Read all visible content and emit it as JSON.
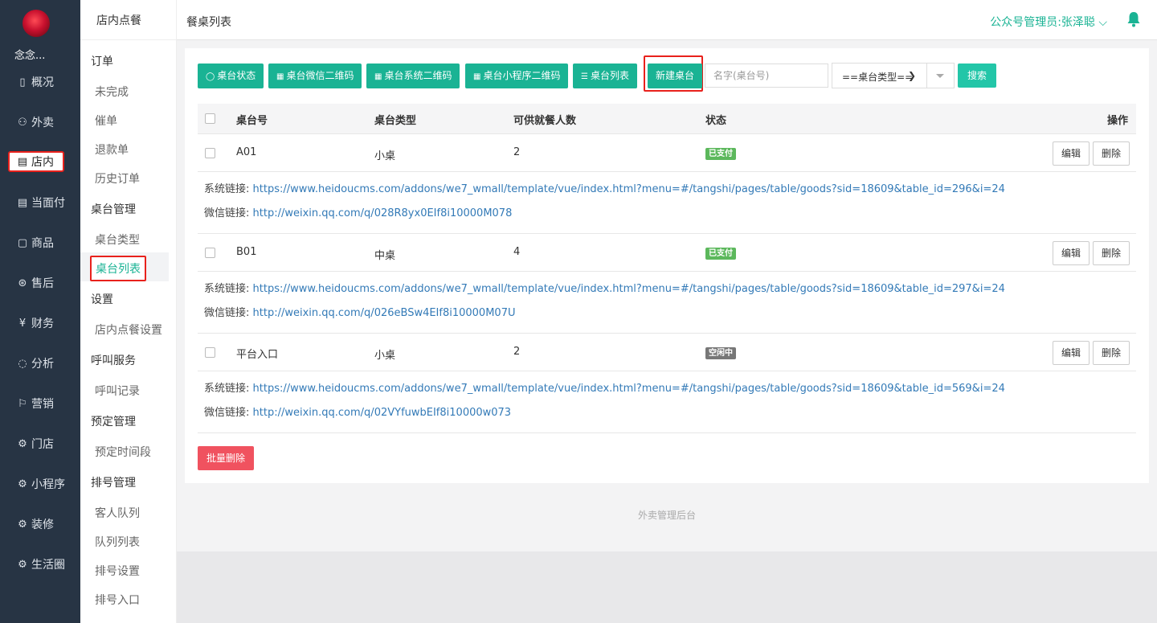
{
  "nav": {
    "shop_name": "念念...",
    "items": [
      {
        "label": "概况",
        "icon": "dashboard-icon",
        "glyph": "▯"
      },
      {
        "label": "外卖",
        "icon": "delivery-icon",
        "glyph": "⚇"
      },
      {
        "label": "店内",
        "icon": "store-icon",
        "glyph": "▤"
      },
      {
        "label": "当面付",
        "icon": "receipt-icon",
        "glyph": "▤"
      },
      {
        "label": "商品",
        "icon": "bag-icon",
        "glyph": "▢"
      },
      {
        "label": "售后",
        "icon": "service-icon",
        "glyph": "⊛"
      },
      {
        "label": "财务",
        "icon": "yuan-icon",
        "glyph": "¥"
      },
      {
        "label": "分析",
        "icon": "chart-icon",
        "glyph": "◌"
      },
      {
        "label": "营销",
        "icon": "flag-icon",
        "glyph": "⚐"
      },
      {
        "label": "门店",
        "icon": "gear-icon",
        "glyph": "⚙"
      },
      {
        "label": "小程序",
        "icon": "gear-icon",
        "glyph": "⚙"
      },
      {
        "label": "装修",
        "icon": "gear-icon",
        "glyph": "⚙"
      },
      {
        "label": "生活圈",
        "icon": "gear-icon",
        "glyph": "⚙"
      }
    ]
  },
  "subnav": {
    "header": "店内点餐",
    "groups": [
      "订单",
      "桌台管理",
      "设置",
      "呼叫服务",
      "预定管理",
      "排号管理"
    ],
    "items": [
      "未完成",
      "催单",
      "退款单",
      "历史订单",
      "桌台类型",
      "桌台列表",
      "店内点餐设置",
      "呼叫记录",
      "预定时间段",
      "客人队列",
      "队列列表",
      "排号设置",
      "排号入口"
    ]
  },
  "topbar": {
    "breadcrumb": "餐桌列表",
    "user": "公众号管理员:张泽聪 ⌵"
  },
  "toolbar": {
    "table_status": "桌台状态",
    "wechat_qr": "桌台微信二维码",
    "system_qr": "桌台系统二维码",
    "miniprogram_qr": "桌台小程序二维码",
    "table_list": "桌台列表",
    "new_table": "新建桌台",
    "search_placeholder": "名字(桌台号)",
    "type_select": "==桌台类型==",
    "search": "搜索"
  },
  "table": {
    "headers": {
      "number": "桌台号",
      "type": "桌台类型",
      "seats": "可供就餐人数",
      "status": "状态",
      "actions": "操作"
    },
    "link_labels": {
      "system": "系统链接:",
      "wechat": "微信链接:"
    },
    "edit": "编辑",
    "delete": "删除",
    "rows": [
      {
        "number": "A01",
        "type": "小桌",
        "seats": "2",
        "status": "已支付",
        "status_color": "#5cb85c",
        "system_link": "https://www.heidoucms.com/addons/we7_wmall/template/vue/index.html?menu=#/tangshi/pages/table/goods?sid=18609&table_id=296&i=24",
        "wechat_link": "http://weixin.qq.com/q/028R8yx0EIf8i10000M078"
      },
      {
        "number": "B01",
        "type": "中桌",
        "seats": "4",
        "status": "已支付",
        "status_color": "#5cb85c",
        "system_link": "https://www.heidoucms.com/addons/we7_wmall/template/vue/index.html?menu=#/tangshi/pages/table/goods?sid=18609&table_id=297&i=24",
        "wechat_link": "http://weixin.qq.com/q/026eBSw4EIf8i10000M07U"
      },
      {
        "number": "平台入口",
        "type": "小桌",
        "seats": "2",
        "status": "空闲中",
        "status_color": "#777777",
        "system_link": "https://www.heidoucms.com/addons/we7_wmall/template/vue/index.html?menu=#/tangshi/pages/table/goods?sid=18609&table_id=569&i=24",
        "wechat_link": "http://weixin.qq.com/q/02VYfuwbEIf8i10000w073"
      }
    ],
    "batch_delete": "批量删除"
  },
  "footer": "外卖管理后台",
  "colors": {
    "accent": "#1ab394",
    "highlight_border": "#e8211c",
    "danger": "#f0525f",
    "sidebar_bg": "#273444"
  }
}
